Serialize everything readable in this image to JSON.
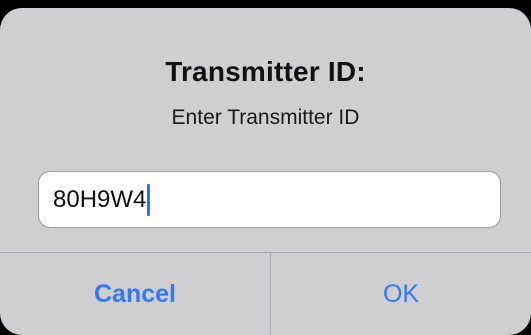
{
  "dialog": {
    "title": "Transmitter ID:",
    "message": "Enter Transmitter ID",
    "input": {
      "value": "80H9W4",
      "placeholder": ""
    },
    "buttons": {
      "cancel_label": "Cancel",
      "ok_label": "OK"
    },
    "colors": {
      "accent": "#3478f6",
      "caret": "#2f6bff",
      "dialog_background": "#cfcfd1"
    }
  }
}
